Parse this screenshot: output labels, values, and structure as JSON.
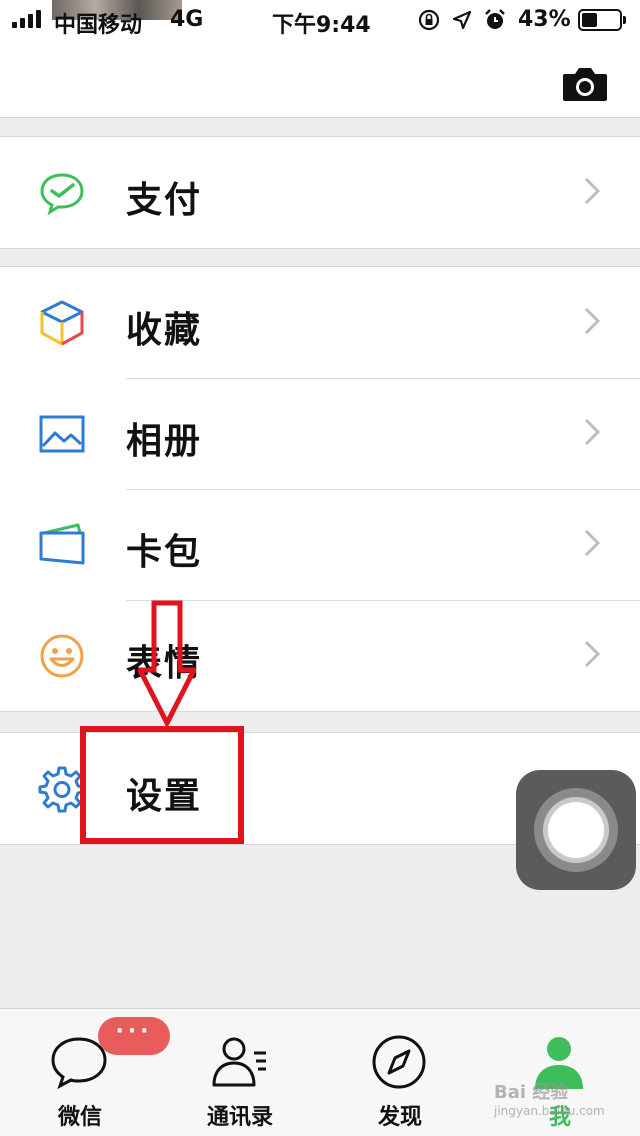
{
  "status_bar": {
    "carrier": "中国移动",
    "network": "4G",
    "time": "下午9:44",
    "battery_percent": "43%",
    "battery_level": 0.43
  },
  "header": {
    "camera_icon": "camera-icon"
  },
  "menu": {
    "pay": {
      "label": "支付",
      "icon": "wechat-pay-icon",
      "color": "#3fbd5a"
    },
    "favorites": {
      "label": "收藏",
      "icon": "favorites-cube-icon"
    },
    "album": {
      "label": "相册",
      "icon": "album-icon",
      "color": "#2e7bd6"
    },
    "cards": {
      "label": "卡包",
      "icon": "card-wallet-icon",
      "color": "#2e7bd6"
    },
    "stickers": {
      "label": "表情",
      "icon": "smiley-icon",
      "color": "#f0a24a"
    },
    "settings": {
      "label": "设置",
      "icon": "gear-icon",
      "color": "#2e7bd6"
    }
  },
  "annotation": {
    "color": "#e0141e"
  },
  "tab_bar": {
    "tabs": [
      {
        "label": "微信",
        "icon": "chat-bubble-icon",
        "badge": "···"
      },
      {
        "label": "通讯录",
        "icon": "contacts-icon"
      },
      {
        "label": "发现",
        "icon": "compass-icon"
      },
      {
        "label": "我",
        "icon": "me-person-icon",
        "active": true
      }
    ],
    "active_color": "#3fbd5a"
  },
  "watermark": {
    "line1": "Bai 经验",
    "line2": "jingyan.baidu.com"
  }
}
